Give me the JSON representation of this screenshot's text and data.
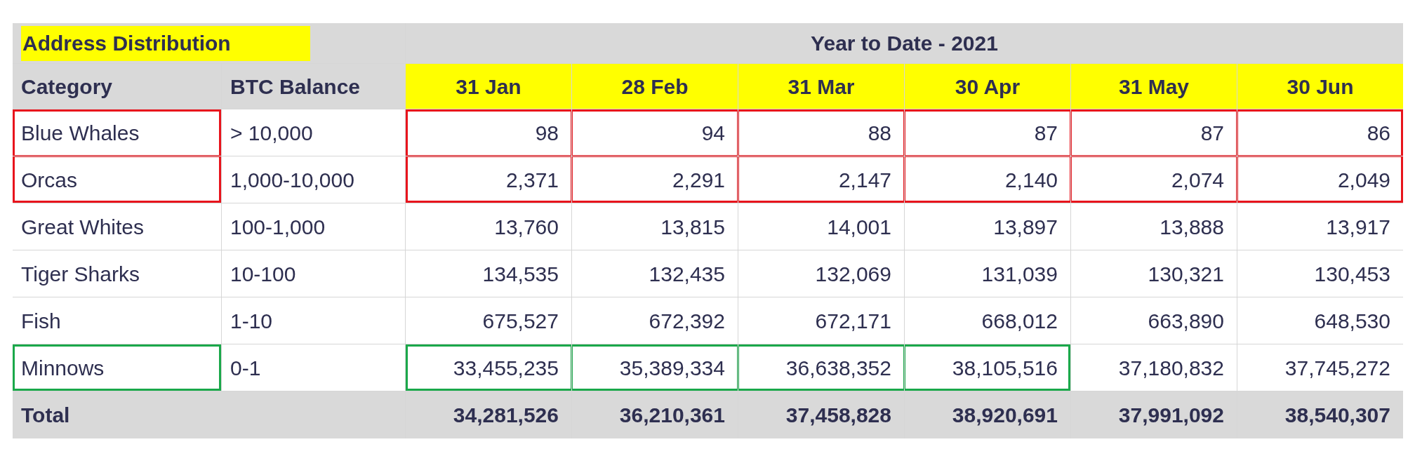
{
  "title": "Address Distribution",
  "period": "Year to Date - 2021",
  "columns": [
    "Category",
    "BTC Balance"
  ],
  "dates": [
    "31 Jan",
    "28 Feb",
    "31 Mar",
    "30 Apr",
    "31 May",
    "30 Jun"
  ],
  "rows": [
    {
      "category": "Blue Whales",
      "balance": "> 10,000",
      "color": "#e8141c",
      "category_boxed": true,
      "values": [
        {
          "text": "98",
          "boxed": true
        },
        {
          "text": "94",
          "boxed": true
        },
        {
          "text": "88",
          "boxed": true
        },
        {
          "text": "87",
          "boxed": true
        },
        {
          "text": "87",
          "boxed": true
        },
        {
          "text": "86",
          "boxed": true
        }
      ]
    },
    {
      "category": "Orcas",
      "balance": "1,000-10,000",
      "color": "#e8141c",
      "category_boxed": true,
      "values": [
        {
          "text": "2,371",
          "boxed": true
        },
        {
          "text": "2,291",
          "boxed": true
        },
        {
          "text": "2,147",
          "boxed": true
        },
        {
          "text": "2,140",
          "boxed": true
        },
        {
          "text": "2,074",
          "boxed": true
        },
        {
          "text": "2,049",
          "boxed": true
        }
      ]
    },
    {
      "category": "Great Whites",
      "balance": "100-1,000",
      "category_boxed": false,
      "values": [
        {
          "text": "13,760",
          "boxed": false
        },
        {
          "text": "13,815",
          "boxed": false
        },
        {
          "text": "14,001",
          "boxed": false
        },
        {
          "text": "13,897",
          "boxed": false
        },
        {
          "text": "13,888",
          "boxed": false
        },
        {
          "text": "13,917",
          "boxed": false
        }
      ]
    },
    {
      "category": "Tiger Sharks",
      "balance": "10-100",
      "category_boxed": false,
      "values": [
        {
          "text": "134,535",
          "boxed": false
        },
        {
          "text": "132,435",
          "boxed": false
        },
        {
          "text": "132,069",
          "boxed": false
        },
        {
          "text": "131,039",
          "boxed": false
        },
        {
          "text": "130,321",
          "boxed": false
        },
        {
          "text": "130,453",
          "boxed": false
        }
      ]
    },
    {
      "category": "Fish",
      "balance": "1-10",
      "category_boxed": false,
      "values": [
        {
          "text": "675,527",
          "boxed": false
        },
        {
          "text": "672,392",
          "boxed": false
        },
        {
          "text": "672,171",
          "boxed": false
        },
        {
          "text": "668,012",
          "boxed": false
        },
        {
          "text": "663,890",
          "boxed": false
        },
        {
          "text": "648,530",
          "boxed": false
        }
      ]
    },
    {
      "category": "Minnows",
      "balance": "0-1",
      "color": "#1aa84a",
      "category_boxed": true,
      "values": [
        {
          "text": "33,455,235",
          "boxed": true
        },
        {
          "text": "35,389,334",
          "boxed": true
        },
        {
          "text": "36,638,352",
          "boxed": true
        },
        {
          "text": "38,105,516",
          "boxed": true
        },
        {
          "text": "37,180,832",
          "boxed": false
        },
        {
          "text": "37,745,272",
          "boxed": false
        }
      ]
    }
  ],
  "total": {
    "label": "Total",
    "values": [
      "34,281,526",
      "36,210,361",
      "37,458,828",
      "38,920,691",
      "37,991,092",
      "38,540,307"
    ]
  }
}
